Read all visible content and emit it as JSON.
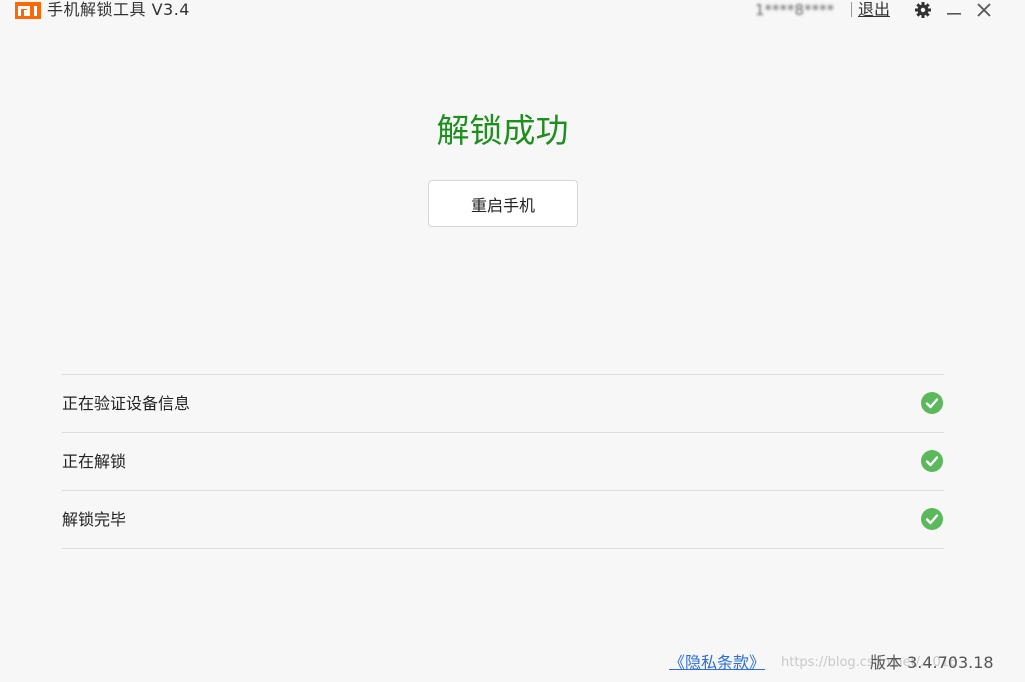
{
  "titlebar": {
    "app_title": "手机解锁工具  V3.4",
    "account_id": "1****8****",
    "logout_label": "退出"
  },
  "main": {
    "result_title": "解锁成功",
    "reboot_button_label": "重启手机"
  },
  "steps": [
    {
      "label": "正在验证设备信息",
      "status": "done"
    },
    {
      "label": "正在解锁",
      "status": "done"
    },
    {
      "label": "解锁完毕",
      "status": "done"
    }
  ],
  "footer": {
    "privacy_link": "《隐私条款》",
    "version_label": "版本 3.4.703.18",
    "watermark": "https://blog.csdn.net/...016"
  },
  "colors": {
    "brand_orange": "#ff6700",
    "success_green": "#1e8f1e",
    "check_green": "#5cb85c",
    "link_blue": "#2d6fd6"
  },
  "icons": [
    "mi-logo-icon",
    "gear-icon",
    "minimize-icon",
    "close-icon",
    "check-circle-icon"
  ]
}
